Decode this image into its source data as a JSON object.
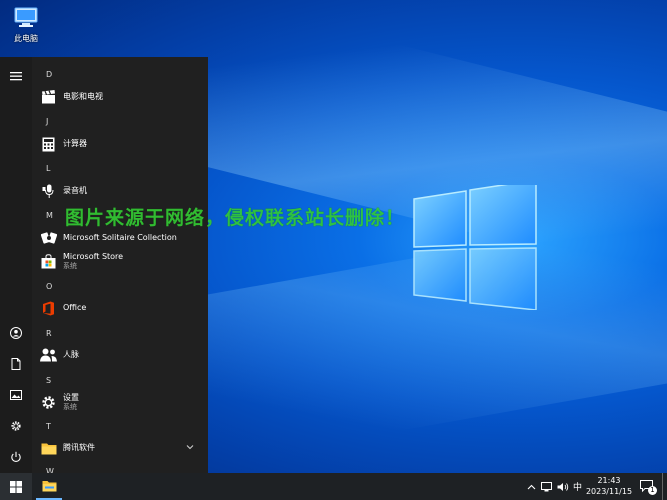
{
  "desktop": {
    "icons": [
      {
        "label": "此电脑",
        "icon": "computer-icon"
      }
    ],
    "watermark": "图片来源于网络，侵权联系站长删除！"
  },
  "start_menu": {
    "groups": [
      {
        "letter": "D",
        "apps": [
          {
            "name": "电影和电视",
            "icon": "film-clapper-icon"
          }
        ]
      },
      {
        "letter": "J",
        "apps": [
          {
            "name": "计算器",
            "icon": "calculator-icon"
          }
        ]
      },
      {
        "letter": "L",
        "apps": [
          {
            "name": "录音机",
            "icon": "microphone-icon"
          }
        ]
      },
      {
        "letter": "M",
        "apps": [
          {
            "name": "Microsoft Solitaire Collection",
            "icon": "cards-icon"
          },
          {
            "name": "Microsoft Store",
            "sub": "系统",
            "icon": "store-bag-icon"
          }
        ]
      },
      {
        "letter": "O",
        "apps": [
          {
            "name": "Office",
            "icon": "office-icon"
          }
        ]
      },
      {
        "letter": "R",
        "apps": [
          {
            "name": "人脉",
            "icon": "people-icon"
          }
        ]
      },
      {
        "letter": "S",
        "apps": [
          {
            "name": "设置",
            "sub": "系统",
            "icon": "gear-icon"
          }
        ]
      },
      {
        "letter": "T",
        "apps": [
          {
            "name": "腾讯软件",
            "icon": "folder-icon",
            "expandable": true
          }
        ]
      },
      {
        "letter": "W",
        "apps": []
      }
    ]
  },
  "taskbar": {
    "tray": {
      "ime": "中",
      "time": "21:43",
      "date": "2023/11/15",
      "notification_count": "1"
    }
  }
}
